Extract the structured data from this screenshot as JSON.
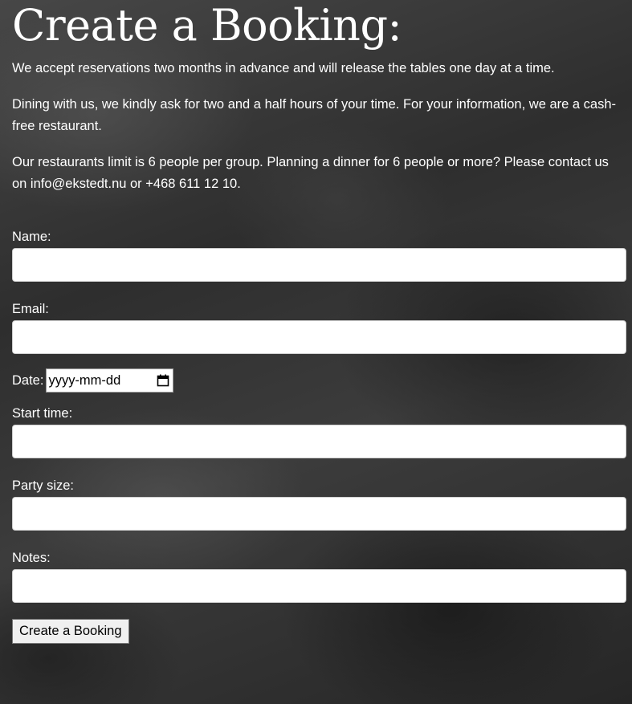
{
  "page": {
    "title": "Create a Booking:",
    "paragraphs": [
      "We accept reservations two months in advance and will release the tables one day at a time.",
      "Dining with us, we kindly ask for two and a half hours of your time. For your information, we are a cash-free restaurant.",
      "Our restaurants limit is 6 people per group. Planning a dinner for 6 people or more? Please contact us on info@ekstedt.nu or +468 611 12 10."
    ]
  },
  "form": {
    "name_label": "Name:",
    "name_value": "",
    "email_label": "Email:",
    "email_value": "",
    "date_label": "Date:",
    "date_placeholder": "yyyy-mm-dd",
    "date_icon": "calendar-icon",
    "start_time_label": "Start time:",
    "start_time_value": "",
    "party_size_label": "Party size:",
    "party_size_value": "",
    "notes_label": "Notes:",
    "notes_value": "",
    "submit_label": "Create a Booking"
  },
  "colors": {
    "text": "#ffffff",
    "background": "#3a3a3a",
    "input_background": "#ffffff",
    "button_background": "#f0f0f0"
  }
}
